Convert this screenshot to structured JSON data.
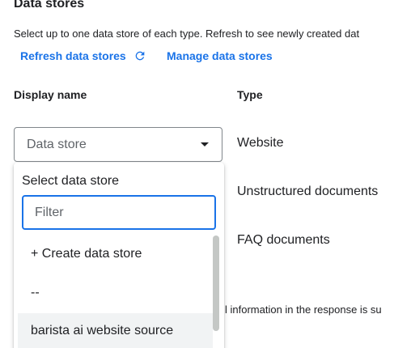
{
  "section": {
    "title": "Data stores",
    "description": "Select up to one data store of each type. Refresh to see newly created dat"
  },
  "links": {
    "refresh": "Refresh data stores",
    "manage": "Manage data stores"
  },
  "table": {
    "headers": {
      "display_name": "Display name",
      "type": "Type"
    },
    "types": [
      "Website",
      "Unstructured documents",
      "FAQ documents"
    ],
    "select_placeholder": "Data store",
    "partial_text": "l information in the response is su"
  },
  "dropdown": {
    "heading": "Select data store",
    "filter_placeholder": "Filter",
    "options": [
      "+ Create data store",
      "--",
      "barista ai website source"
    ]
  },
  "colors": {
    "accent": "#1a73e8",
    "text": "#202124",
    "hover": "#f1f3f4"
  },
  "icons": {
    "refresh": "refresh-icon",
    "caret": "caret-down-icon"
  }
}
